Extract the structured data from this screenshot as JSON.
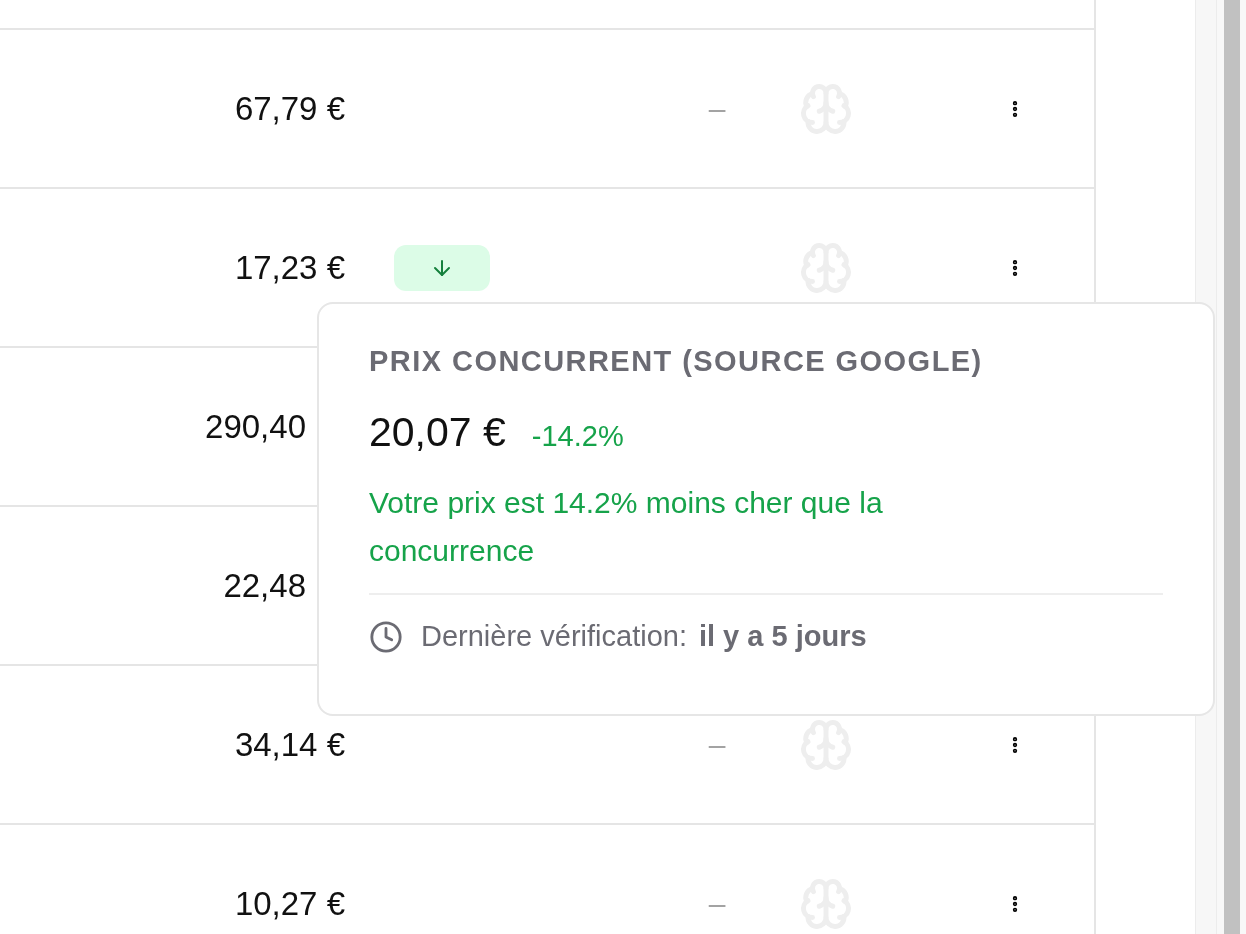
{
  "rows": [
    {
      "kind": "full",
      "price": "67,79 €",
      "price_down": false,
      "dash": "–"
    },
    {
      "kind": "full",
      "price": "17,23 €",
      "price_down": true
    },
    {
      "kind": "covered",
      "price": "290,40"
    },
    {
      "kind": "covered",
      "price": "22,48"
    },
    {
      "kind": "full",
      "price": "34,14 €",
      "price_down": false,
      "dash": "–"
    },
    {
      "kind": "full",
      "price": "10,27 €",
      "price_down": false,
      "dash": "–"
    }
  ],
  "tooltip": {
    "title": "PRIX CONCURRENT (SOURCE GOOGLE)",
    "price": "20,07 €",
    "difference": "-14.2%",
    "message": "Votre prix est 14.2% moins cher que la concurrence",
    "last_check_label": "Dernière vérification:",
    "last_check_value": "il y a 5 jours"
  }
}
